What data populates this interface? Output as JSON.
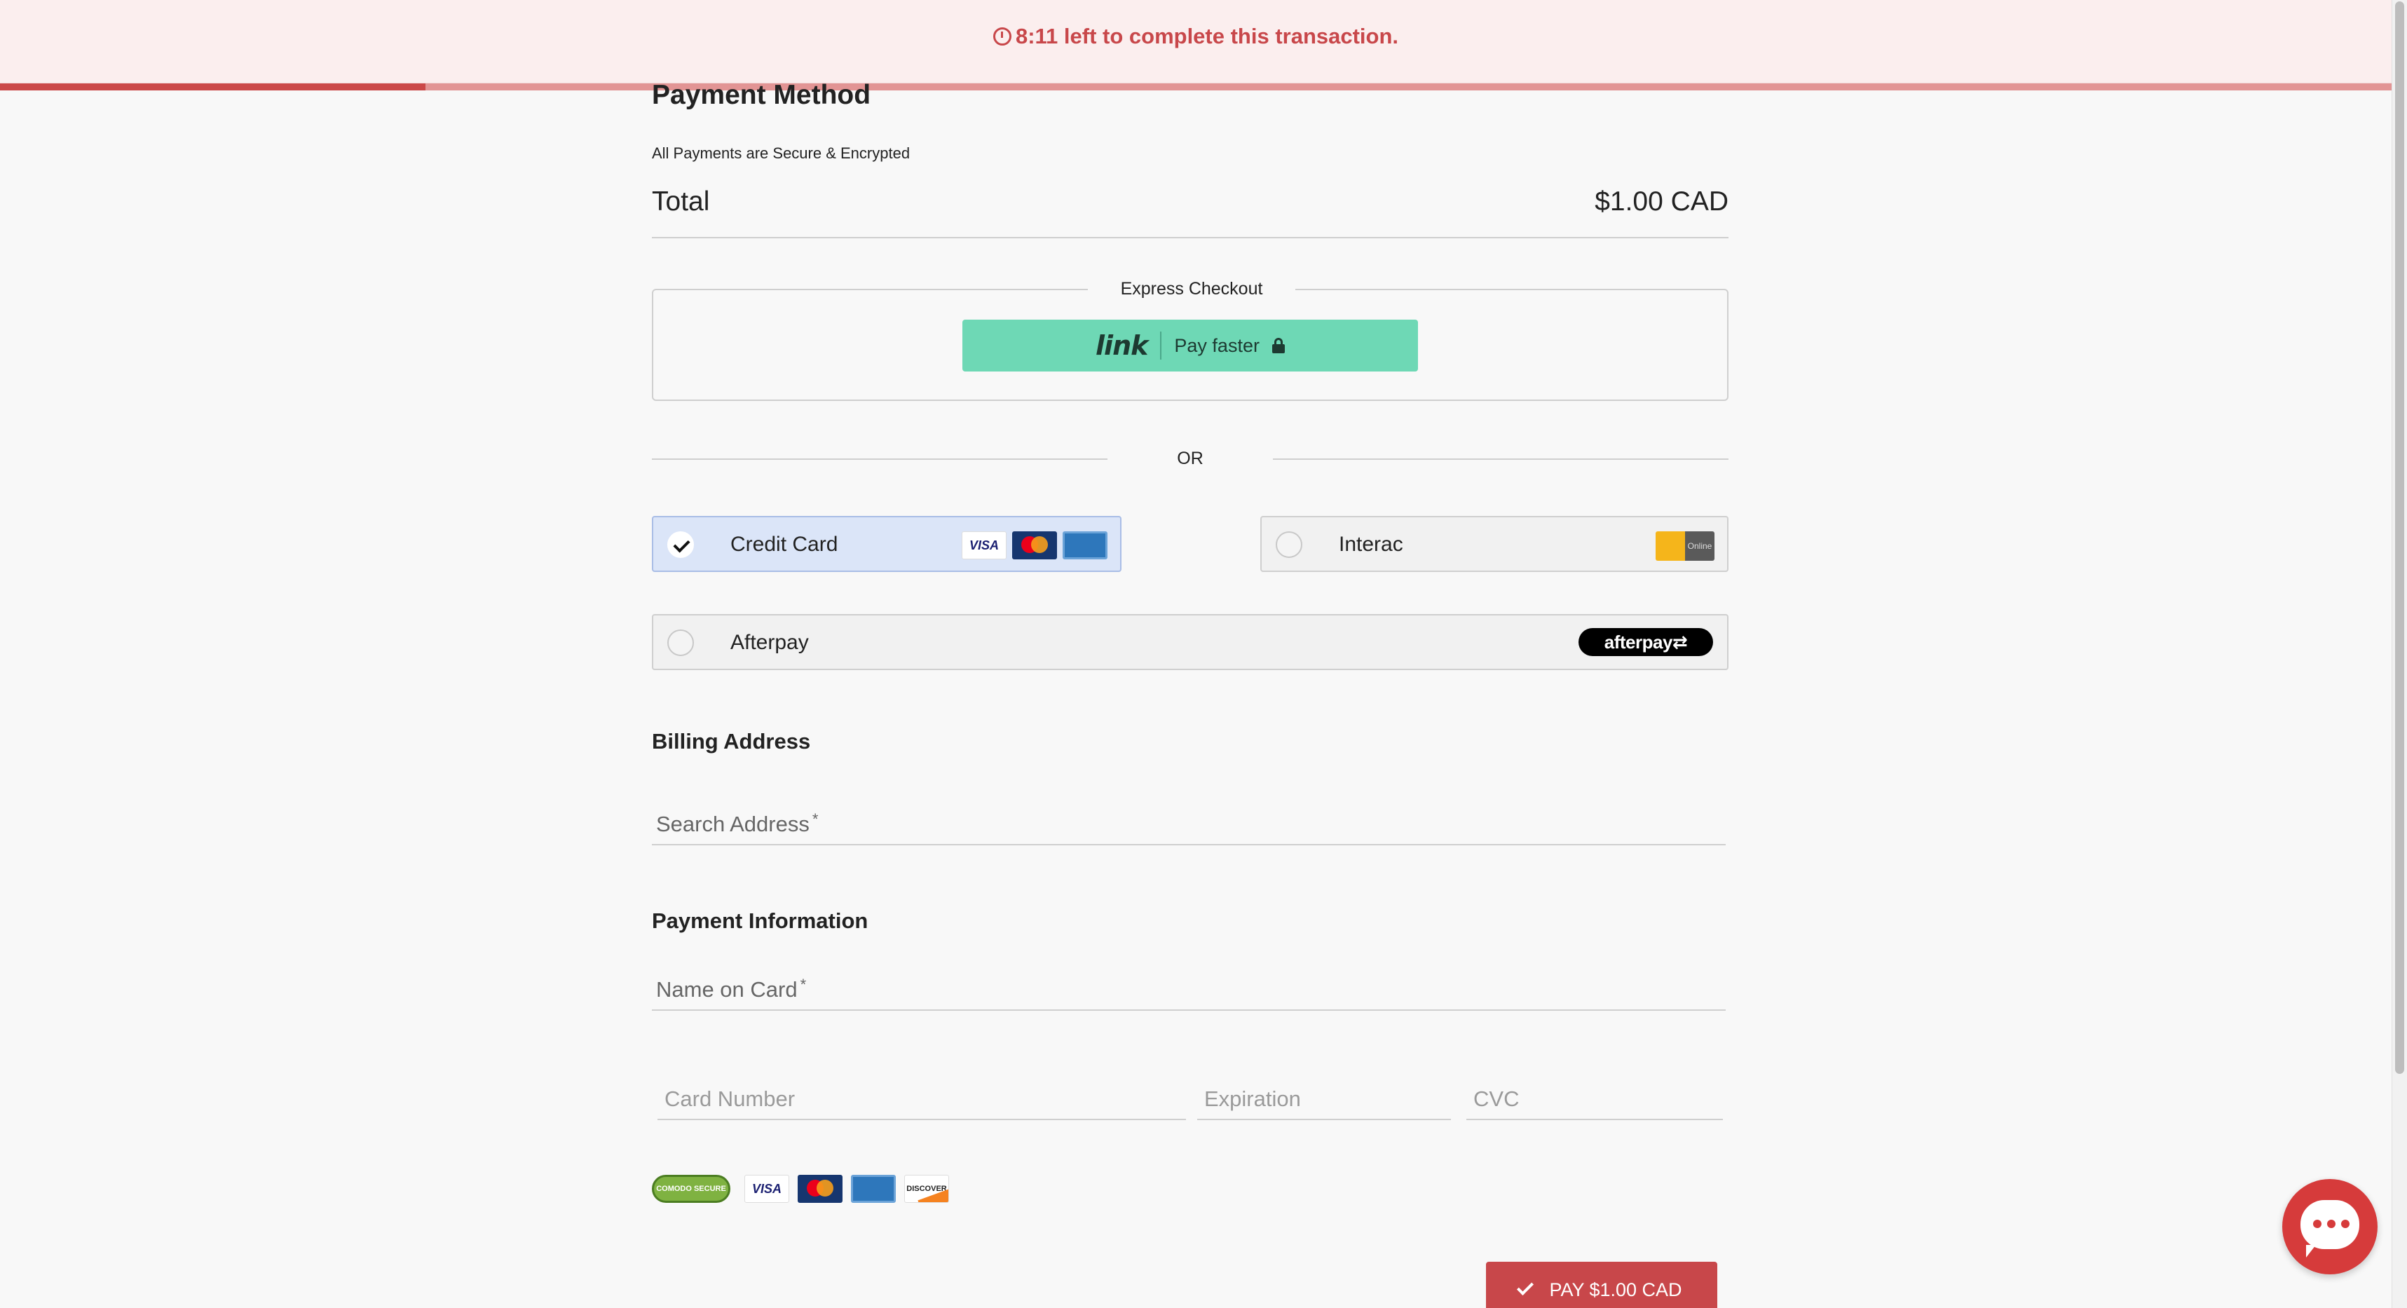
{
  "timer": {
    "text": "8:11 left to complete this transaction.",
    "progress_fraction": 0.178
  },
  "payment": {
    "title": "Payment Method",
    "secure_note": "All Payments are Secure & Encrypted",
    "total_label": "Total",
    "total_value": "$1.00 CAD"
  },
  "express": {
    "legend": "Express Checkout",
    "link_logo": "link",
    "link_text": "Pay faster"
  },
  "or_text": "OR",
  "methods": [
    {
      "label": "Credit Card",
      "selected": true
    },
    {
      "label": "Interac",
      "selected": false
    },
    {
      "label": "Afterpay",
      "selected": false
    }
  ],
  "logos": {
    "visa": "VISA",
    "afterpay": "afterpay⇄",
    "interac_online": "Online",
    "comodo": "COMODO SECURE",
    "discover": "DISCOVER"
  },
  "billing": {
    "heading": "Billing Address",
    "search_label": "Search Address",
    "required_mark": "*"
  },
  "payment_info": {
    "heading": "Payment Information",
    "name_label": "Name on Card",
    "required_mark": "*",
    "card_number_placeholder": "Card Number",
    "expiration_placeholder": "Expiration",
    "cvc_placeholder": "CVC"
  },
  "pay_button": {
    "label": "PAY $1.00 CAD"
  },
  "colors": {
    "accent": "#c8474a",
    "link_green": "#6ed8b5",
    "selected_bg": "#dbe5f8"
  }
}
